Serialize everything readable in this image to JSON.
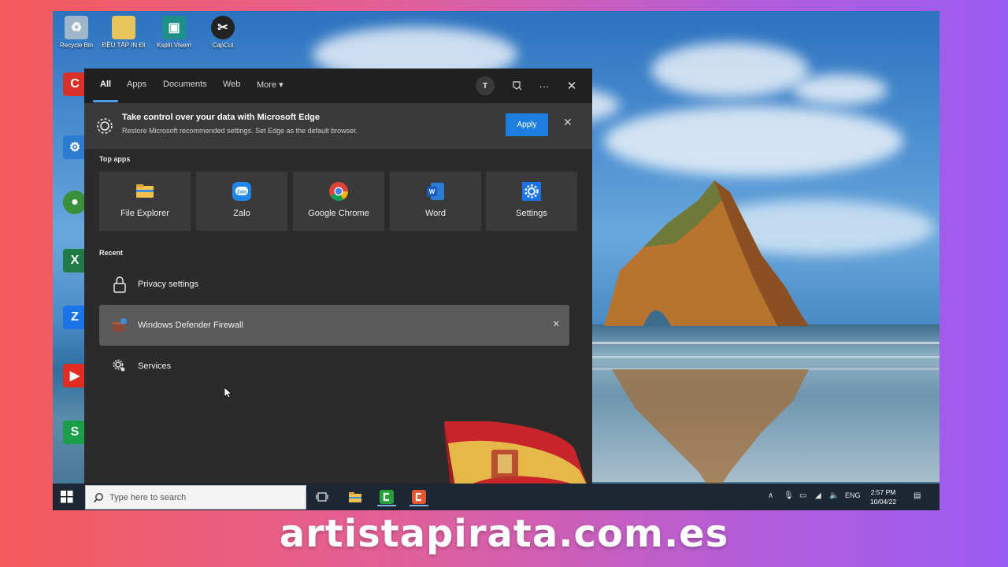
{
  "desktop": {
    "icons": [
      {
        "label": "Recycle Bin",
        "icon": "recycle-bin-icon",
        "color": "#9fb6c8"
      },
      {
        "label": "ĐỀU TẬP IN ĐI",
        "icon": "folder-icon",
        "color": "#e8c25a"
      },
      {
        "label": "Ksplit Visem",
        "icon": "app-icon",
        "color": "#1f8f8a"
      },
      {
        "label": "CapCut",
        "icon": "capcut-icon",
        "color": "#222222"
      }
    ],
    "left_icons": [
      {
        "label": "Ccleaner",
        "icon": "ccleaner-icon",
        "color": "#d9312a",
        "glyph": "C"
      },
      {
        "label": "Control Panel",
        "icon": "control-panel-icon",
        "color": "#2d7bd1",
        "glyph": "⚙"
      },
      {
        "label": "Google Chrome",
        "icon": "chrome-icon",
        "color": "#3a8f3a",
        "glyph": "●"
      },
      {
        "label": "Excel",
        "icon": "excel-icon",
        "color": "#1e7b45",
        "glyph": "X"
      },
      {
        "label": "Zalo",
        "icon": "zalo-icon",
        "color": "#1a73e8",
        "glyph": "Z"
      },
      {
        "label": "YouTube",
        "icon": "youtube-icon",
        "color": "#e02b20",
        "glyph": "▶"
      },
      {
        "label": "Sublime",
        "icon": "sublime-icon",
        "color": "#1a9e4a",
        "glyph": "S"
      }
    ]
  },
  "search_panel": {
    "tabs": [
      "All",
      "Apps",
      "Documents",
      "Web",
      "More"
    ],
    "active_tab": "All",
    "more_chevron": "▾",
    "avatar_initial": "T",
    "banner": {
      "title": "Take control over your data with Microsoft Edge",
      "description": "Restore Microsoft recommended settings. Set Edge as the default browser.",
      "apply_label": "Apply",
      "close_glyph": "✕"
    },
    "top_apps_title": "Top apps",
    "top_apps": [
      {
        "label": "File Explorer",
        "icon": "file-explorer-icon"
      },
      {
        "label": "Zalo",
        "icon": "zalo-icon"
      },
      {
        "label": "Google Chrome",
        "icon": "chrome-icon"
      },
      {
        "label": "Word",
        "icon": "word-icon"
      },
      {
        "label": "Settings",
        "icon": "settings-icon"
      }
    ],
    "recent_title": "Recent",
    "recent": [
      {
        "label": "Privacy settings",
        "icon": "lock-icon"
      },
      {
        "label": "Windows Defender Firewall",
        "icon": "firewall-icon",
        "hover": true
      },
      {
        "label": "Services",
        "icon": "services-gear-icon"
      }
    ]
  },
  "taskbar": {
    "search_placeholder": "Type here to search",
    "language": "ENG",
    "time": "2:57 PM",
    "date": "10/04/22"
  },
  "watermark": "artistapirata.com.es",
  "colors": {
    "accent": "#1b7ee0",
    "panel_bg": "#2b2b2b",
    "tab_underline": "#4c9fe8",
    "taskbar_bg": "#1c2733"
  }
}
